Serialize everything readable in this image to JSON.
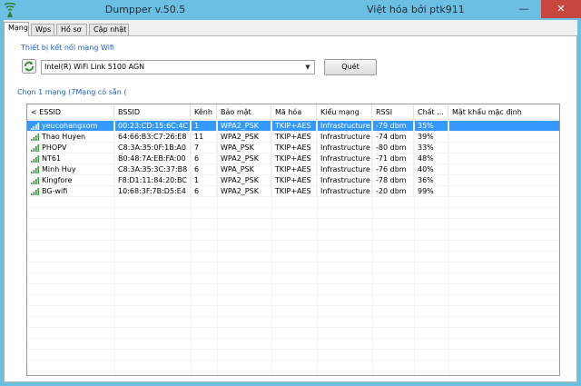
{
  "window": {
    "title": "Dumpper v.50.5",
    "credit": "Việt hóa bởi ptk911",
    "minimize": "—",
    "close": "✕"
  },
  "tabs": [
    {
      "label": "Mạng",
      "active": true
    },
    {
      "label": "Wps",
      "active": false
    },
    {
      "label": "Hồ sơ",
      "active": false
    },
    {
      "label": "Cập nhật",
      "active": false
    }
  ],
  "adapter": {
    "section_label": "Thiết bị kết nối mạng Wifi",
    "selected": "Intel(R) WiFi Link 5100 AGN",
    "scan_label": "Quét"
  },
  "networks": {
    "section_label": "Chọn 1 mạng (7Mạng có sẵn (",
    "columns": [
      "< ESSID",
      "BSSID",
      "Kênh",
      "Bảo mật",
      "Mã hóa",
      "Kiểu mạng",
      "RSSI",
      "Chất ...",
      "Mật khẩu mặc định"
    ],
    "rows": [
      {
        "essid": "yeucohangxom",
        "bssid": "00:23:CD:15:6C:4C",
        "channel": "1",
        "security": "WPA2_PSK",
        "encryption": "TKIP+AES",
        "type": "Infrastructure",
        "rssi": "-79 dbm",
        "quality": "35%",
        "default_password": "",
        "selected": true
      },
      {
        "essid": "Thao Huyen",
        "bssid": "64:66:B3:C7:26:E8",
        "channel": "11",
        "security": "WPA2_PSK",
        "encryption": "TKIP+AES",
        "type": "Infrastructure",
        "rssi": "-74 dbm",
        "quality": "39%",
        "default_password": "",
        "selected": false
      },
      {
        "essid": "PHOPV",
        "bssid": "C8:3A:35:0F:1B:A0",
        "channel": "7",
        "security": "WPA_PSK",
        "encryption": "TKIP+AES",
        "type": "Infrastructure",
        "rssi": "-80 dbm",
        "quality": "33%",
        "default_password": "",
        "selected": false
      },
      {
        "essid": "NT61",
        "bssid": "B0:48:7A:EB:FA:00",
        "channel": "6",
        "security": "WPA2_PSK",
        "encryption": "TKIP+AES",
        "type": "Infrastructure",
        "rssi": "-71 dbm",
        "quality": "48%",
        "default_password": "",
        "selected": false
      },
      {
        "essid": "Minh Huy",
        "bssid": "C8:3A:35:3C:37:B8",
        "channel": "6",
        "security": "WPA_PSK",
        "encryption": "TKIP+AES",
        "type": "Infrastructure",
        "rssi": "-76 dbm",
        "quality": "40%",
        "default_password": "",
        "selected": false
      },
      {
        "essid": "Kingfore",
        "bssid": "F8:D1:11:84:20:BC",
        "channel": "1",
        "security": "WPA2_PSK",
        "encryption": "TKIP+AES",
        "type": "Infrastructure",
        "rssi": "-78 dbm",
        "quality": "36%",
        "default_password": "",
        "selected": false
      },
      {
        "essid": "BG-wifi",
        "bssid": "10:68:3F:7B:D5:E4",
        "channel": "6",
        "security": "WPA2_PSK",
        "encryption": "TKIP+AES",
        "type": "Infrastructure",
        "rssi": "-20 dbm",
        "quality": "99%",
        "default_password": "",
        "selected": false
      }
    ]
  },
  "colors": {
    "window_frame": "#6bbfe2",
    "selection": "#3399ff",
    "section_label": "#1e5fc8",
    "signal": "#3a9a3a"
  },
  "icons": {
    "app": "wifi-antenna-icon",
    "refresh": "refresh-icon",
    "signal": "signal-bars-icon",
    "dropdown": "chevron-down-icon"
  }
}
